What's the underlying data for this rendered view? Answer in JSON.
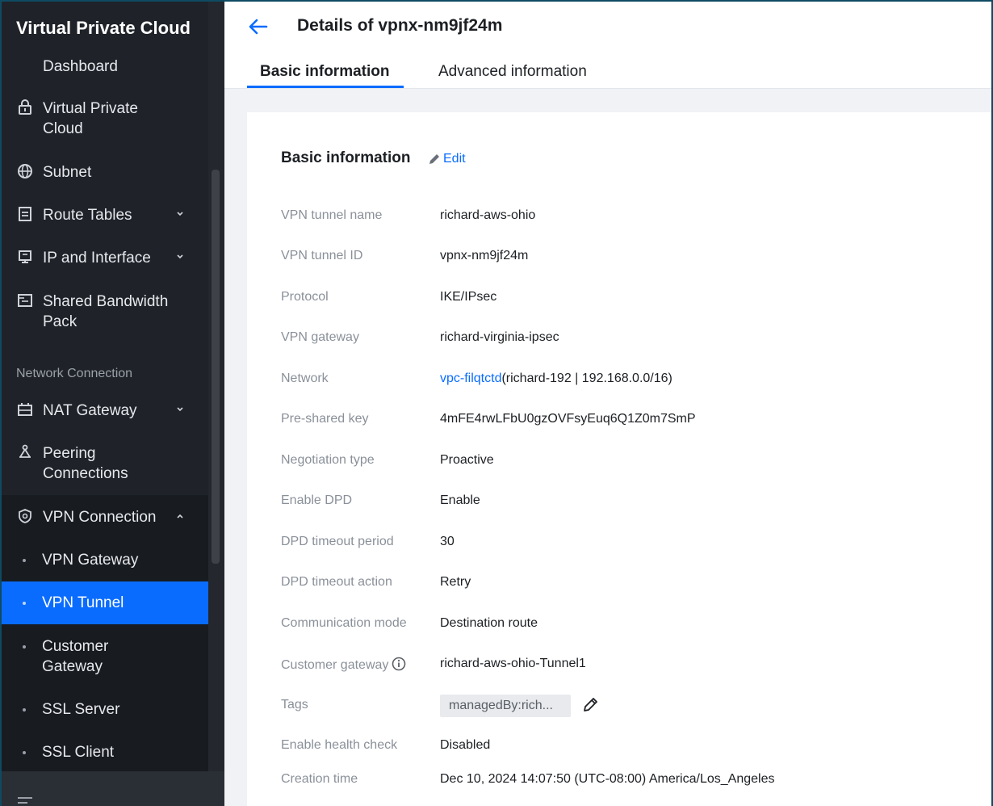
{
  "sidebar": {
    "title": "Virtual Private Cloud",
    "items": [
      {
        "label": "Dashboard",
        "icon": "dashboard-icon"
      },
      {
        "label": "Virtual Private Cloud",
        "icon": "lock-icon"
      },
      {
        "label": "Subnet",
        "icon": "globe-icon"
      },
      {
        "label": "Route Tables",
        "icon": "document-icon",
        "expandable": true
      },
      {
        "label": "IP and Interface",
        "icon": "monitor-icon",
        "expandable": true
      },
      {
        "label": "Shared Bandwidth Pack",
        "icon": "folder-icon"
      }
    ],
    "section_label": "Network Connection",
    "network_items": [
      {
        "label": "NAT Gateway",
        "icon": "nat-gateway-icon",
        "expandable": true
      },
      {
        "label": "Peering Connections",
        "icon": "peering-icon"
      },
      {
        "label": "VPN Connection",
        "icon": "vpn-shield-icon",
        "expanded": true
      }
    ],
    "vpn_subitems": [
      {
        "label": "VPN Gateway"
      },
      {
        "label": "VPN Tunnel",
        "active": true
      },
      {
        "label": "Customer Gateway"
      },
      {
        "label": "SSL Server"
      },
      {
        "label": "SSL Client"
      }
    ]
  },
  "header": {
    "title": "Details of vpnx-nm9jf24m",
    "tabs": [
      {
        "label": "Basic information",
        "active": true
      },
      {
        "label": "Advanced information",
        "active": false
      }
    ]
  },
  "card": {
    "title": "Basic information",
    "edit_label": "Edit",
    "fields": [
      {
        "key": "VPN tunnel name",
        "value": "richard-aws-ohio"
      },
      {
        "key": "VPN tunnel ID",
        "value": "vpnx-nm9jf24m"
      },
      {
        "key": "Protocol",
        "value": "IKE/IPsec"
      },
      {
        "key": "VPN gateway",
        "value": "richard-virginia-ipsec"
      },
      {
        "key": "Network",
        "link": "vpc-filqtctd",
        "value": "(richard-192 | 192.168.0.0/16)"
      },
      {
        "key": "Pre-shared key",
        "value": "4mFE4rwLFbU0gzOVFsyEuq6Q1Z0m7SmP"
      },
      {
        "key": "Negotiation type",
        "value": "Proactive"
      },
      {
        "key": "Enable DPD",
        "value": "Enable"
      },
      {
        "key": "DPD timeout period",
        "value": "30"
      },
      {
        "key": "DPD timeout action",
        "value": "Retry"
      },
      {
        "key": "Communication mode",
        "value": "Destination route"
      },
      {
        "key": "Customer gateway",
        "value": "richard-aws-ohio-Tunnel1"
      },
      {
        "key": "Tags",
        "value": "managedBy:rich..."
      },
      {
        "key": "Enable health check",
        "value": "Disabled"
      },
      {
        "key": "Creation time",
        "value": "Dec 10, 2024 14:07:50 (UTC-08:00) America/Los_Angeles"
      }
    ]
  },
  "colors": {
    "sidebar_bg": "#1f2329",
    "accent": "#0a6cff",
    "active_item_bg": "#0a6cff"
  }
}
